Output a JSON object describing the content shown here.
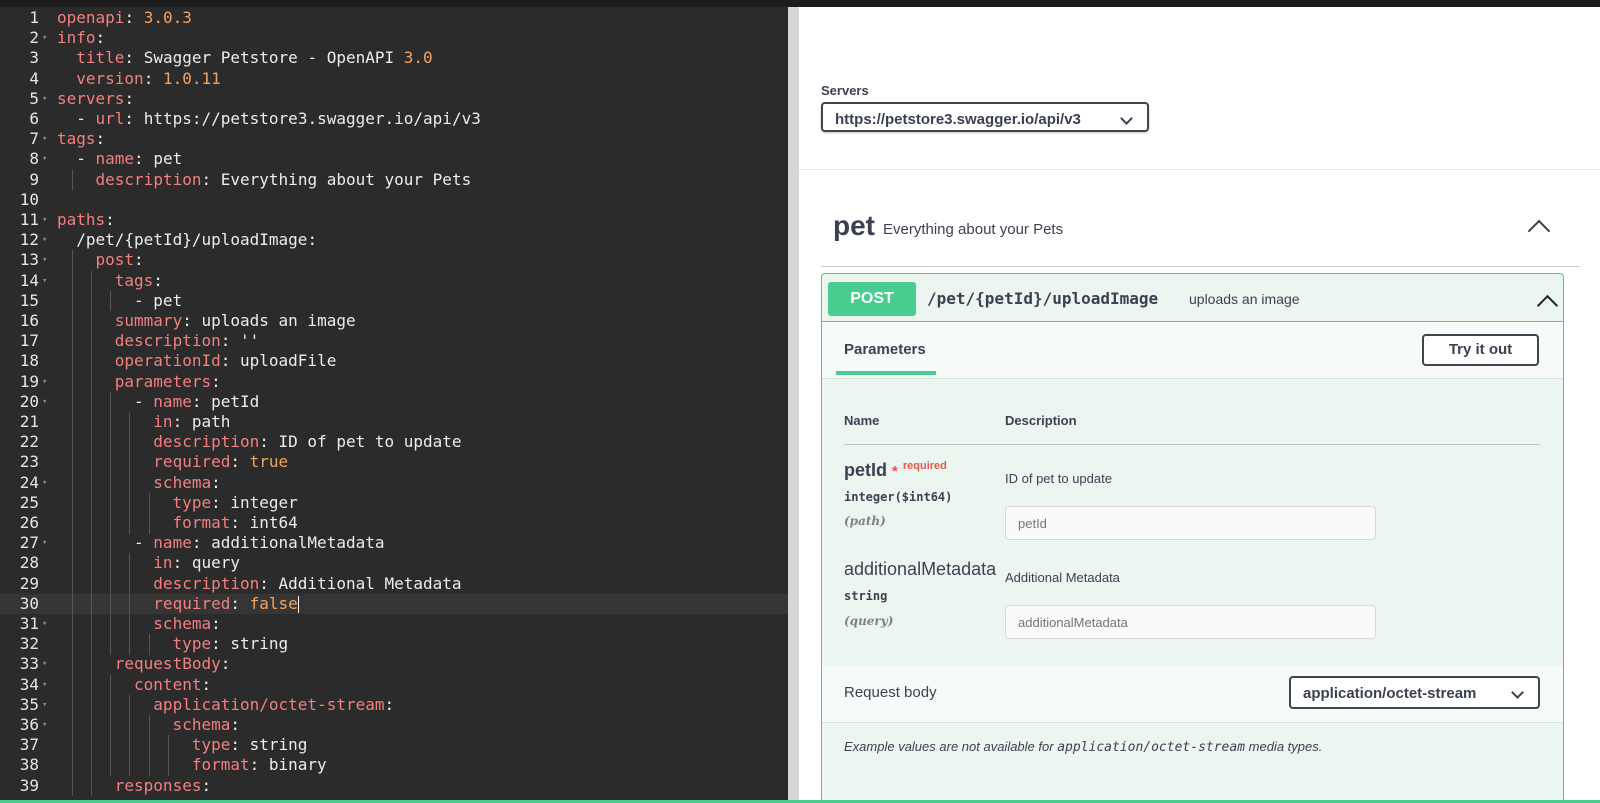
{
  "editor": {
    "lines": [
      {
        "num": "1",
        "fold": false,
        "indent": 0,
        "guides": 0,
        "parts": [
          {
            "t": "openapi",
            "c": "k"
          },
          {
            "t": ": ",
            "c": "s"
          },
          {
            "t": "3.0.3",
            "c": "n"
          }
        ]
      },
      {
        "num": "2",
        "fold": true,
        "indent": 0,
        "guides": 0,
        "parts": [
          {
            "t": "info",
            "c": "k"
          },
          {
            "t": ":",
            "c": "s"
          }
        ]
      },
      {
        "num": "3",
        "fold": false,
        "indent": 1,
        "guides": 0,
        "parts": [
          {
            "t": "title",
            "c": "k"
          },
          {
            "t": ": Swagger Petstore - OpenAPI ",
            "c": "s"
          },
          {
            "t": "3.0",
            "c": "n"
          }
        ]
      },
      {
        "num": "4",
        "fold": false,
        "indent": 1,
        "guides": 0,
        "parts": [
          {
            "t": "version",
            "c": "k"
          },
          {
            "t": ": ",
            "c": "s"
          },
          {
            "t": "1.0.11",
            "c": "n"
          }
        ]
      },
      {
        "num": "5",
        "fold": true,
        "indent": 0,
        "guides": 0,
        "parts": [
          {
            "t": "servers",
            "c": "k"
          },
          {
            "t": ":",
            "c": "s"
          }
        ]
      },
      {
        "num": "6",
        "fold": false,
        "indent": 1,
        "guides": 0,
        "parts": [
          {
            "t": "- ",
            "c": "s"
          },
          {
            "t": "url",
            "c": "k"
          },
          {
            "t": ": https://petstore3.swagger.io/api/v3",
            "c": "s"
          }
        ]
      },
      {
        "num": "7",
        "fold": true,
        "indent": 0,
        "guides": 0,
        "parts": [
          {
            "t": "tags",
            "c": "k"
          },
          {
            "t": ":",
            "c": "s"
          }
        ]
      },
      {
        "num": "8",
        "fold": true,
        "indent": 1,
        "guides": 0,
        "parts": [
          {
            "t": "- ",
            "c": "s"
          },
          {
            "t": "name",
            "c": "k"
          },
          {
            "t": ": pet",
            "c": "s"
          }
        ]
      },
      {
        "num": "9",
        "fold": false,
        "indent": 2,
        "guides": 1,
        "parts": [
          {
            "t": "description",
            "c": "k"
          },
          {
            "t": ": Everything about your Pets",
            "c": "s"
          }
        ]
      },
      {
        "num": "10",
        "fold": false,
        "indent": 0,
        "guides": 0,
        "parts": []
      },
      {
        "num": "11",
        "fold": true,
        "indent": 0,
        "guides": 0,
        "parts": [
          {
            "t": "paths",
            "c": "k"
          },
          {
            "t": ":",
            "c": "s"
          }
        ]
      },
      {
        "num": "12",
        "fold": true,
        "indent": 1,
        "guides": 0,
        "parts": [
          {
            "t": "/pet/{petId}/uploadImage:",
            "c": "s"
          }
        ]
      },
      {
        "num": "13",
        "fold": true,
        "indent": 2,
        "guides": 1,
        "parts": [
          {
            "t": "post",
            "c": "k"
          },
          {
            "t": ":",
            "c": "s"
          }
        ]
      },
      {
        "num": "14",
        "fold": true,
        "indent": 3,
        "guides": 2,
        "parts": [
          {
            "t": "tags",
            "c": "k"
          },
          {
            "t": ":",
            "c": "s"
          }
        ]
      },
      {
        "num": "15",
        "fold": false,
        "indent": 4,
        "guides": 3,
        "parts": [
          {
            "t": "- pet",
            "c": "s"
          }
        ]
      },
      {
        "num": "16",
        "fold": false,
        "indent": 3,
        "guides": 2,
        "parts": [
          {
            "t": "summary",
            "c": "k"
          },
          {
            "t": ": uploads an image",
            "c": "s"
          }
        ]
      },
      {
        "num": "17",
        "fold": false,
        "indent": 3,
        "guides": 2,
        "parts": [
          {
            "t": "description",
            "c": "k"
          },
          {
            "t": ": ''",
            "c": "s"
          }
        ]
      },
      {
        "num": "18",
        "fold": false,
        "indent": 3,
        "guides": 2,
        "parts": [
          {
            "t": "operationId",
            "c": "k"
          },
          {
            "t": ": uploadFile",
            "c": "s"
          }
        ]
      },
      {
        "num": "19",
        "fold": true,
        "indent": 3,
        "guides": 2,
        "parts": [
          {
            "t": "parameters",
            "c": "k"
          },
          {
            "t": ":",
            "c": "s"
          }
        ]
      },
      {
        "num": "20",
        "fold": true,
        "indent": 4,
        "guides": 3,
        "parts": [
          {
            "t": "- ",
            "c": "s"
          },
          {
            "t": "name",
            "c": "k"
          },
          {
            "t": ": petId",
            "c": "s"
          }
        ]
      },
      {
        "num": "21",
        "fold": false,
        "indent": 5,
        "guides": 4,
        "parts": [
          {
            "t": "in",
            "c": "k"
          },
          {
            "t": ": path",
            "c": "s"
          }
        ]
      },
      {
        "num": "22",
        "fold": false,
        "indent": 5,
        "guides": 4,
        "parts": [
          {
            "t": "description",
            "c": "k"
          },
          {
            "t": ": ID of pet to update",
            "c": "s"
          }
        ]
      },
      {
        "num": "23",
        "fold": false,
        "indent": 5,
        "guides": 4,
        "parts": [
          {
            "t": "required",
            "c": "k"
          },
          {
            "t": ": ",
            "c": "s"
          },
          {
            "t": "true",
            "c": "n"
          }
        ]
      },
      {
        "num": "24",
        "fold": true,
        "indent": 5,
        "guides": 4,
        "parts": [
          {
            "t": "schema",
            "c": "k"
          },
          {
            "t": ":",
            "c": "s"
          }
        ]
      },
      {
        "num": "25",
        "fold": false,
        "indent": 6,
        "guides": 5,
        "parts": [
          {
            "t": "type",
            "c": "k"
          },
          {
            "t": ": integer",
            "c": "s"
          }
        ]
      },
      {
        "num": "26",
        "fold": false,
        "indent": 6,
        "guides": 5,
        "parts": [
          {
            "t": "format",
            "c": "k"
          },
          {
            "t": ": int64",
            "c": "s"
          }
        ]
      },
      {
        "num": "27",
        "fold": true,
        "indent": 4,
        "guides": 3,
        "parts": [
          {
            "t": "- ",
            "c": "s"
          },
          {
            "t": "name",
            "c": "k"
          },
          {
            "t": ": additionalMetadata",
            "c": "s"
          }
        ]
      },
      {
        "num": "28",
        "fold": false,
        "indent": 5,
        "guides": 4,
        "parts": [
          {
            "t": "in",
            "c": "k"
          },
          {
            "t": ": query",
            "c": "s"
          }
        ]
      },
      {
        "num": "29",
        "fold": false,
        "indent": 5,
        "guides": 4,
        "parts": [
          {
            "t": "description",
            "c": "k"
          },
          {
            "t": ": Additional Metadata",
            "c": "s"
          }
        ]
      },
      {
        "num": "30",
        "fold": false,
        "indent": 5,
        "guides": 4,
        "active": true,
        "caret": true,
        "parts": [
          {
            "t": "required",
            "c": "k"
          },
          {
            "t": ": ",
            "c": "s"
          },
          {
            "t": "false",
            "c": "n"
          }
        ]
      },
      {
        "num": "31",
        "fold": true,
        "indent": 5,
        "guides": 4,
        "parts": [
          {
            "t": "schema",
            "c": "k"
          },
          {
            "t": ":",
            "c": "s"
          }
        ]
      },
      {
        "num": "32",
        "fold": false,
        "indent": 6,
        "guides": 5,
        "parts": [
          {
            "t": "type",
            "c": "k"
          },
          {
            "t": ": string",
            "c": "s"
          }
        ]
      },
      {
        "num": "33",
        "fold": true,
        "indent": 3,
        "guides": 2,
        "parts": [
          {
            "t": "requestBody",
            "c": "k"
          },
          {
            "t": ":",
            "c": "s"
          }
        ]
      },
      {
        "num": "34",
        "fold": true,
        "indent": 4,
        "guides": 3,
        "parts": [
          {
            "t": "content",
            "c": "k"
          },
          {
            "t": ":",
            "c": "s"
          }
        ]
      },
      {
        "num": "35",
        "fold": true,
        "indent": 5,
        "guides": 4,
        "parts": [
          {
            "t": "application/octet-stream",
            "c": "k"
          },
          {
            "t": ":",
            "c": "s"
          }
        ]
      },
      {
        "num": "36",
        "fold": true,
        "indent": 6,
        "guides": 5,
        "parts": [
          {
            "t": "schema",
            "c": "k"
          },
          {
            "t": ":",
            "c": "s"
          }
        ]
      },
      {
        "num": "37",
        "fold": false,
        "indent": 7,
        "guides": 6,
        "parts": [
          {
            "t": "type",
            "c": "k"
          },
          {
            "t": ": string",
            "c": "s"
          }
        ]
      },
      {
        "num": "38",
        "fold": false,
        "indent": 7,
        "guides": 6,
        "parts": [
          {
            "t": "format",
            "c": "k"
          },
          {
            "t": ": binary",
            "c": "s"
          }
        ]
      },
      {
        "num": "39",
        "fold": false,
        "indent": 3,
        "guides": 2,
        "parts": [
          {
            "t": "responses",
            "c": "k"
          },
          {
            "t": ":",
            "c": "s"
          }
        ]
      }
    ]
  },
  "servers": {
    "label": "Servers",
    "selected": "https://petstore3.swagger.io/api/v3"
  },
  "tag": {
    "name": "pet",
    "description": "Everything about your Pets"
  },
  "operation": {
    "method": "POST",
    "path": "/pet/{petId}/uploadImage",
    "summary": "uploads an image",
    "parameters_tab": "Parameters",
    "try_button": "Try it out",
    "col_name": "Name",
    "col_description": "Description",
    "params": [
      {
        "name": "petId",
        "required_star": "*",
        "required_label": "required",
        "type": "integer",
        "format": "($int64)",
        "in": "(path)",
        "description": "ID of pet to update",
        "placeholder": "petId"
      },
      {
        "name": "additionalMetadata",
        "type": "string",
        "in": "(query)",
        "description": "Additional Metadata",
        "placeholder": "additionalMetadata"
      }
    ],
    "request_body_label": "Request body",
    "request_body_type": "application/octet-stream",
    "example_note_prefix": "Example values are not available for ",
    "example_note_mono": "application/octet-stream",
    "example_note_suffix": " media types."
  },
  "colors": {
    "post": "#49cc90",
    "editor_bg": "#2b2b2b",
    "yaml_key": "#f37f7f",
    "yaml_literal": "#f5a35b",
    "required": "#e8564a"
  }
}
